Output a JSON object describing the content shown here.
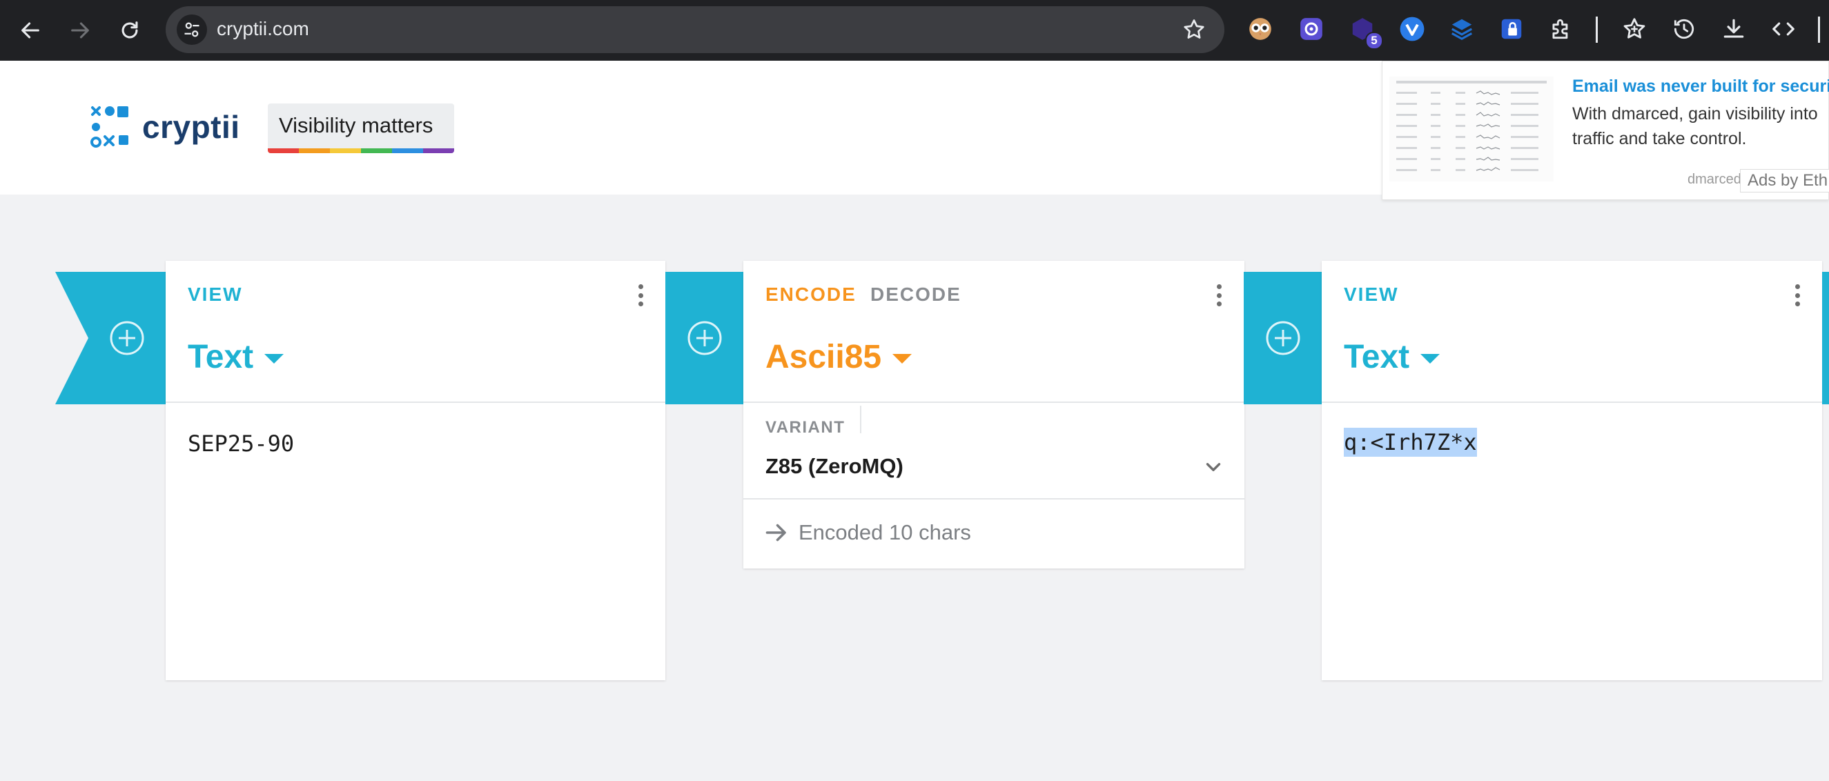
{
  "browser": {
    "url": "cryptii.com",
    "extension_badge": "5"
  },
  "header": {
    "logo_text": "cryptii",
    "slogan": "Visibility matters",
    "rainbow_colors": [
      "#e8413c",
      "#f39c1f",
      "#f5c93a",
      "#43b853",
      "#2d8fe0",
      "#7b3fb2"
    ]
  },
  "ad": {
    "title": "Email was never built for securit",
    "body": "With dmarced, gain visibility into traffic and take control.",
    "domain": "dmarced.eu",
    "by": "Ads by Eth"
  },
  "pipeline": {
    "view_color": "#1fb2d3",
    "encoder_color": "#f7941d",
    "input_view": {
      "label": "VIEW",
      "title": "Text",
      "content": "SEP25-90"
    },
    "encoder": {
      "encode_label": "ENCODE",
      "decode_label": "DECODE",
      "active": "ENCODE",
      "title": "Ascii85",
      "variant_label": "VARIANT",
      "variant_value": "Z85 (ZeroMQ)",
      "status": "Encoded 10 chars"
    },
    "output_view": {
      "label": "VIEW",
      "title": "Text",
      "content": "q:<Irh7Z*x",
      "selected": true
    }
  }
}
